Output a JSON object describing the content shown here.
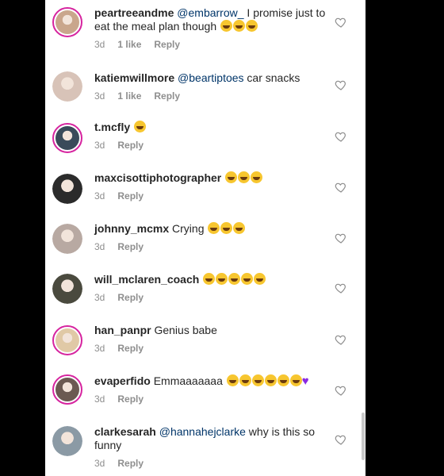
{
  "comments": [
    {
      "user": "peartreeandme",
      "mention": "@embarrow_",
      "text": " I promise just to eat the meal plan though",
      "emojis": 3,
      "heart": false,
      "time": "3d",
      "likes": "1 like",
      "reply": "Reply",
      "ring": true,
      "avatar_color": "#c9a68c"
    },
    {
      "user": "katiemwillmore",
      "mention": "@beartiptoes",
      "text": " car snacks",
      "emojis": 0,
      "heart": false,
      "time": "3d",
      "likes": "1 like",
      "reply": "Reply",
      "ring": false,
      "avatar_color": "#d8c3b8"
    },
    {
      "user": "t.mcfly",
      "mention": "",
      "text": "",
      "emojis": 1,
      "heart": false,
      "time": "3d",
      "likes": "",
      "reply": "Reply",
      "ring": true,
      "avatar_color": "#3a4b5a"
    },
    {
      "user": "maxcisottiphotographer",
      "mention": "",
      "text": "",
      "emojis": 3,
      "heart": false,
      "time": "3d",
      "likes": "",
      "reply": "Reply",
      "ring": false,
      "avatar_color": "#2b2b2b"
    },
    {
      "user": "johnny_mcmx",
      "mention": "",
      "text": " Crying",
      "emojis": 3,
      "heart": false,
      "time": "3d",
      "likes": "",
      "reply": "Reply",
      "ring": false,
      "avatar_color": "#b8a9a2"
    },
    {
      "user": "will_mclaren_coach",
      "mention": "",
      "text": "",
      "emojis": 5,
      "heart": false,
      "time": "3d",
      "likes": "",
      "reply": "Reply",
      "ring": false,
      "avatar_color": "#4a4a3e"
    },
    {
      "user": "han_panpr",
      "mention": "",
      "text": " Genius babe",
      "emojis": 0,
      "heart": false,
      "time": "3d",
      "likes": "",
      "reply": "Reply",
      "ring": true,
      "avatar_color": "#e0c9a6"
    },
    {
      "user": "evaperfido",
      "mention": "",
      "text": " Emmaaaaaaa",
      "emojis": 6,
      "heart": true,
      "time": "3d",
      "likes": "",
      "reply": "Reply",
      "ring": true,
      "avatar_color": "#6b5a52"
    },
    {
      "user": "clarkesarah",
      "mention": "@hannahejclarke",
      "text": " why is this so funny",
      "emojis": 0,
      "heart": false,
      "time": "3d",
      "likes": "",
      "reply": "Reply",
      "ring": false,
      "avatar_color": "#8b9aa5"
    }
  ],
  "colors": {
    "username": "#262626",
    "mention": "#003569",
    "meta": "#8e8e8e",
    "story_ring": "#d6249f"
  },
  "icons": {
    "like": "heart-outline-icon"
  }
}
